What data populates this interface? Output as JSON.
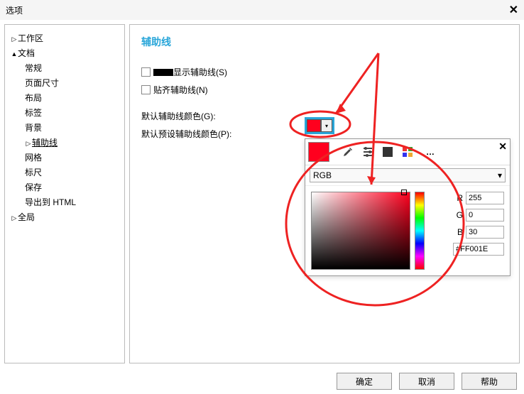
{
  "window": {
    "title": "选项",
    "close": "✕"
  },
  "tree": {
    "workspace": "工作区",
    "document": "文档",
    "doc_children": [
      "常规",
      "页面尺寸",
      "布局",
      "标签",
      "背景",
      "辅助线",
      "网格",
      "标尺",
      "保存",
      "导出到 HTML"
    ],
    "global": "全局",
    "selected": "辅助线"
  },
  "panel": {
    "heading": "辅助线",
    "chk_show": "显示辅助线(S)",
    "chk_snap": "贴齐辅助线(N)",
    "lbl_default_color": "默认辅助线颜色(G):",
    "lbl_preset_color": "默认预设辅助线颜色(P):"
  },
  "picker": {
    "mode": "RGB",
    "r_label": "R",
    "r_val": "255",
    "g_label": "G",
    "g_val": "0",
    "b_label": "B",
    "b_val": "30",
    "hex": "#FF001E"
  },
  "buttons": {
    "ok": "确定",
    "cancel": "取消",
    "help": "帮助"
  }
}
